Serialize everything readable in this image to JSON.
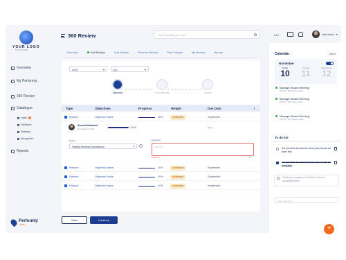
{
  "sidebar": {
    "logo_text": "YOUR LOGO",
    "logo_sub": "TAGLINE HERE",
    "items": [
      {
        "label": "Overview",
        "icon": "overview-icon"
      },
      {
        "label": "My Performly",
        "icon": "user-icon"
      },
      {
        "label": "360 Review",
        "icon": "review-icon"
      },
      {
        "label": "Catalogue",
        "icon": "catalogue-icon"
      }
    ],
    "sub_items": [
      {
        "label": "Tasks",
        "badge": "4"
      },
      {
        "label": "Feedback"
      },
      {
        "label": "Meetings"
      },
      {
        "label": "Recognition"
      }
    ],
    "reports": "Reports",
    "brand_name": "Performly",
    "brand_sub": "Talent"
  },
  "header": {
    "title": "360 Review",
    "search_placeholder": "Search anything you need",
    "lang": "AI",
    "user_name": "User Name",
    "icon_colors": {
      "mail": "#e46f2c",
      "bell": "#e46f2c"
    }
  },
  "tabs": [
    "Overview",
    "Self Review",
    "Sub Review",
    "Reverse Review",
    "Peer Review",
    "My Review",
    "Survey"
  ],
  "filters": {
    "year": "2021",
    "quarter": "Q1"
  },
  "steps": [
    {
      "label": "Objective",
      "state": "active"
    },
    {
      "label": "Competencies",
      "state": "pending"
    },
    {
      "label": "Overall",
      "state": "pending"
    }
  ],
  "table": {
    "headers": [
      "Type",
      "Objectives",
      "Progress",
      "Weight",
      "Due Date"
    ],
    "rows": [
      {
        "type": "Finance",
        "objective": "Objective Name",
        "progress": "10%",
        "weight": "Medium",
        "due": "September"
      },
      {
        "type": "Finance",
        "objective": "Objective Name",
        "progress": "10%",
        "weight": "Medium",
        "due": "September"
      },
      {
        "type": "Finance",
        "objective": "Objective Name",
        "progress": "10%",
        "weight": "Medium",
        "due": "September"
      },
      {
        "type": "Finance",
        "objective": "Objective Name",
        "progress": "10%",
        "weight": "Medium",
        "due": "September"
      },
      {
        "type": "Finance",
        "objective": "Objective Name",
        "progress": "10%",
        "weight": "Medium",
        "due": "September"
      }
    ]
  },
  "detail": {
    "person_name": "Ahmed Mohamed",
    "person_role": "My Assigned Profile",
    "progress": "100%",
    "status": "Done",
    "rating_label": "Rating",
    "rating_value": "Partially Meeting Expectations",
    "comment_label": "Comment",
    "comment_placeholder": "Add note",
    "required": "Required*",
    "count": "0/0"
  },
  "buttons": {
    "save": "Save",
    "continue": "Continue"
  },
  "calendar": {
    "title": "Calendar",
    "view": "Day",
    "month": "November",
    "days": [
      {
        "name": "Today",
        "num": "10"
      },
      {
        "name": "Tuesday",
        "num": "11"
      },
      {
        "name": "Wednesday",
        "num": "12"
      }
    ],
    "meetings": [
      {
        "title": "Manager Board Meeting",
        "time": "9:00 AM",
        "room": "ADC Meeting Room"
      },
      {
        "title": "Manager Board Meeting",
        "time": "9:00 AM",
        "room": "ADC Meeting Room"
      },
      {
        "title": "Manager Board Meeting",
        "time": "9:00 AM",
        "room": "ADC Meeting Room"
      }
    ]
  },
  "todo": {
    "title": "To do list",
    "items": [
      {
        "text": "Set priorities and decide which jobs should be done first.",
        "done": false
      },
      {
        "text": "Set priorities and decide which jobs should be done first.",
        "done": true
      },
      {
        "text": "Track your progress and feel a sense of accomplishment",
        "done": false
      }
    ],
    "input_placeholder": "Add a new task"
  },
  "fab": "+"
}
